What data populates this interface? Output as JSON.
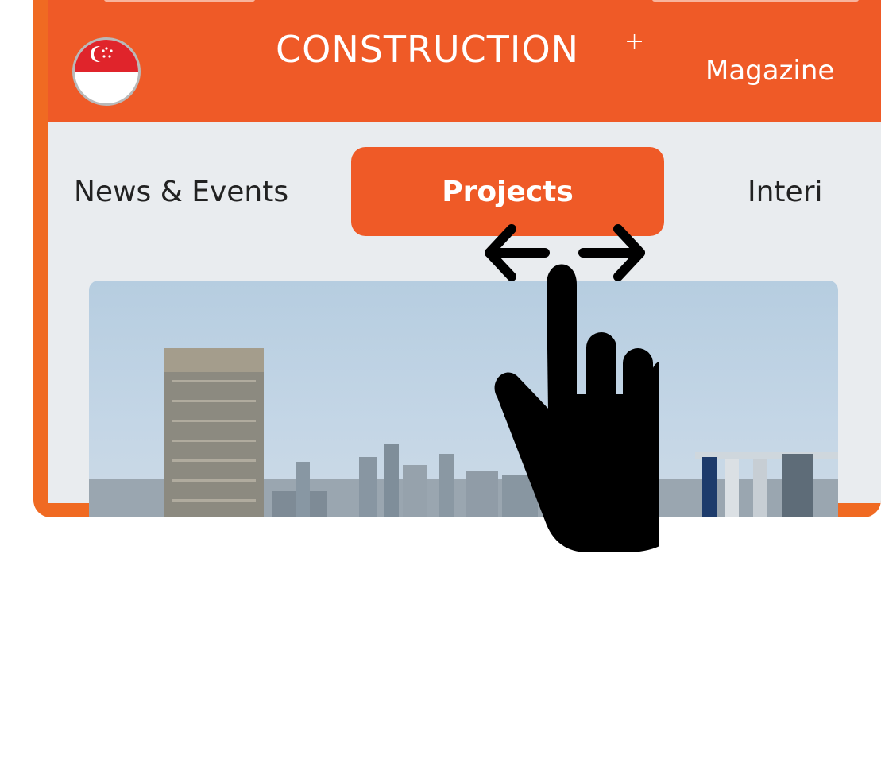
{
  "header": {
    "brand": "CONSTRUCTION",
    "brand_plus": "+",
    "magazine": "Magazine",
    "flag_icon": "singapore-flag-icon"
  },
  "tabs": [
    {
      "label": "News & Events",
      "active": false
    },
    {
      "label": "Projects",
      "active": true
    },
    {
      "label": "Interi",
      "active": false
    }
  ],
  "hero_image": "city-skyline-photo",
  "gesture": {
    "icon": "swipe-horizontal-hand-icon"
  },
  "colors": {
    "accent": "#ef5a27",
    "frame": "#f06a22",
    "tab_bar": "#e9ecef",
    "text": "#222222"
  }
}
